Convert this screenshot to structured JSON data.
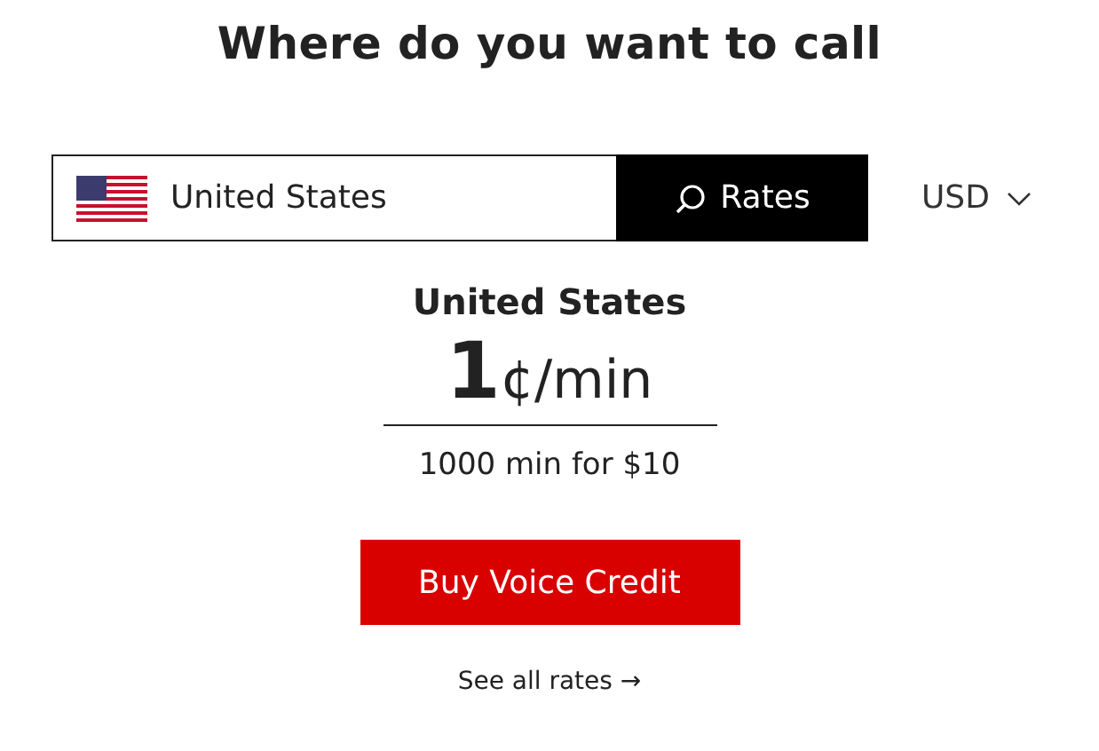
{
  "title": "Where do you want to call",
  "search": {
    "value": "United States",
    "button": "Rates"
  },
  "currency": "USD",
  "result": {
    "country": "United States",
    "price_number": "1",
    "price_unit": "¢/min",
    "bundle": "1000 min for $10"
  },
  "buy_button": "Buy Voice Credit",
  "see_all_link": "See all rates →"
}
